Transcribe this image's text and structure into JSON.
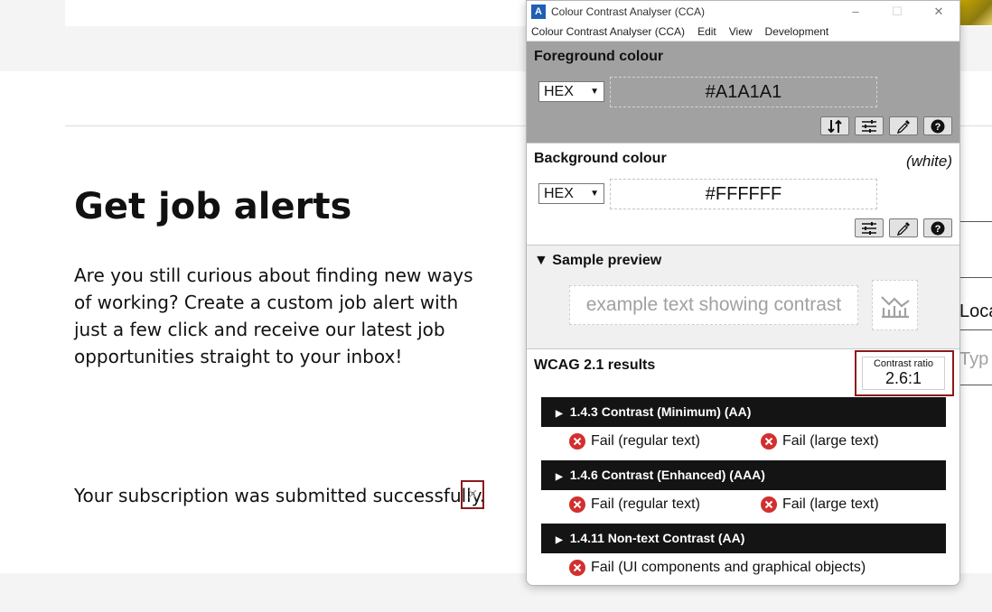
{
  "page": {
    "title": "Get job alerts",
    "intro": "Are you still curious about finding new ways of working? Create a custom job alert with just a few click and receive our latest job opportunities straight to your inbox!",
    "success_message": "Your subscription was submitted successfully.",
    "close_glyph": "×",
    "field_partial_label": "Loca",
    "field_partial_placeholder": "Typ"
  },
  "app": {
    "title": "Colour Contrast Analyser (CCA)",
    "icon_letter": "A",
    "window_buttons": [
      "–",
      "☐",
      "✕"
    ],
    "menu": [
      "Colour Contrast Analyser (CCA)",
      "Edit",
      "View",
      "Development"
    ]
  },
  "foreground": {
    "title": "Foreground colour",
    "format": "HEX",
    "value": "#A1A1A1",
    "color": "#a1a1a1",
    "tools": [
      "swap-icon",
      "sliders-icon",
      "eyedropper-icon",
      "help-icon"
    ]
  },
  "background": {
    "title": "Background colour",
    "name_note": "(white)",
    "format": "HEX",
    "value": "#FFFFFF",
    "color": "#ffffff",
    "tools": [
      "sliders-icon",
      "eyedropper-icon",
      "help-icon"
    ]
  },
  "preview": {
    "title": "▼ Sample preview",
    "sample_text": "example text showing contrast",
    "icon": "chart-icon"
  },
  "results": {
    "title": "WCAG 2.1 results",
    "ratio_label": "Contrast ratio",
    "ratio_value": "2.6:1",
    "fail_color": "#d32f2f",
    "criteria": [
      {
        "label": "1.4.3 Contrast (Minimum) (AA)",
        "results": [
          "Fail (regular text)",
          "Fail (large text)"
        ]
      },
      {
        "label": "1.4.6 Contrast (Enhanced) (AAA)",
        "results": [
          "Fail (regular text)",
          "Fail (large text)"
        ]
      },
      {
        "label": "1.4.11 Non-text Contrast (AA)",
        "results": [
          "Fail (UI components and graphical objects)"
        ]
      }
    ]
  }
}
